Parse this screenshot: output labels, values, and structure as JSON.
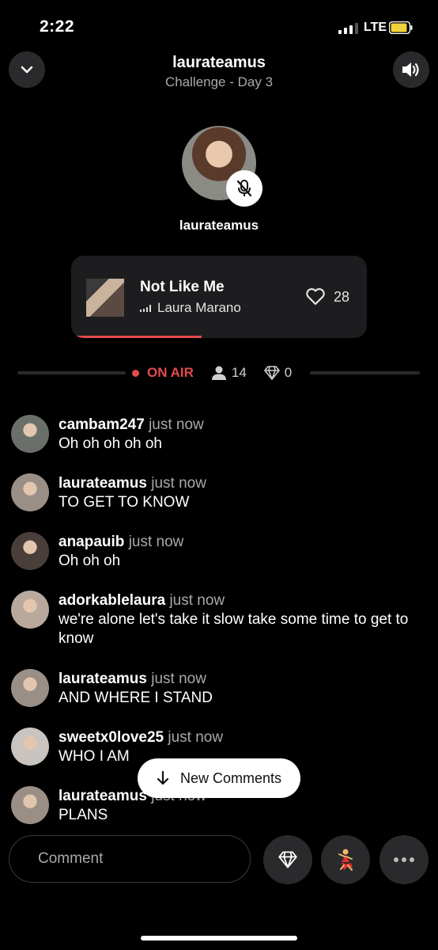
{
  "status_bar": {
    "time": "2:22",
    "network": "LTE"
  },
  "header": {
    "title": "laurateamus",
    "subtitle": "Challenge - Day 3"
  },
  "host": {
    "name": "laurateamus"
  },
  "now_playing": {
    "song": "Not Like Me",
    "artist": "Laura Marano",
    "likes": "28",
    "progress": 0.44
  },
  "live": {
    "status": "ON AIR",
    "listeners": "14",
    "gems": "0"
  },
  "comments": [
    {
      "user": "cambam247",
      "time": "just now",
      "text": "Oh oh oh oh oh",
      "avatar_color": "#6b6f6a"
    },
    {
      "user": "laurateamus",
      "time": "just now",
      "text": "TO GET TO KNOW",
      "avatar_color": "#9a8f86"
    },
    {
      "user": "anapauib",
      "time": "just now",
      "text": "Oh oh oh",
      "avatar_color": "#4a3e3a"
    },
    {
      "user": "adorkablelaura",
      "time": "just now",
      "text": "we're alone let's take it slow take some time to get to know",
      "avatar_color": "#b8a99c"
    },
    {
      "user": "laurateamus",
      "time": "just now",
      "text": "AND WHERE I STAND",
      "avatar_color": "#9a8f86"
    },
    {
      "user": "sweetx0love25",
      "time": "just now",
      "text": "WHO I AM",
      "avatar_color": "#c9c4c0"
    },
    {
      "user": "laurateamus",
      "time": "just now",
      "text": "PLANS",
      "avatar_color": "#9a8f86"
    }
  ],
  "new_comments_label": "New Comments",
  "comment_input": {
    "placeholder": "Comment"
  },
  "colors": {
    "accent_red": "#e24b4b",
    "card_bg": "#1d1d1f",
    "button_bg": "#2a2a2c"
  }
}
